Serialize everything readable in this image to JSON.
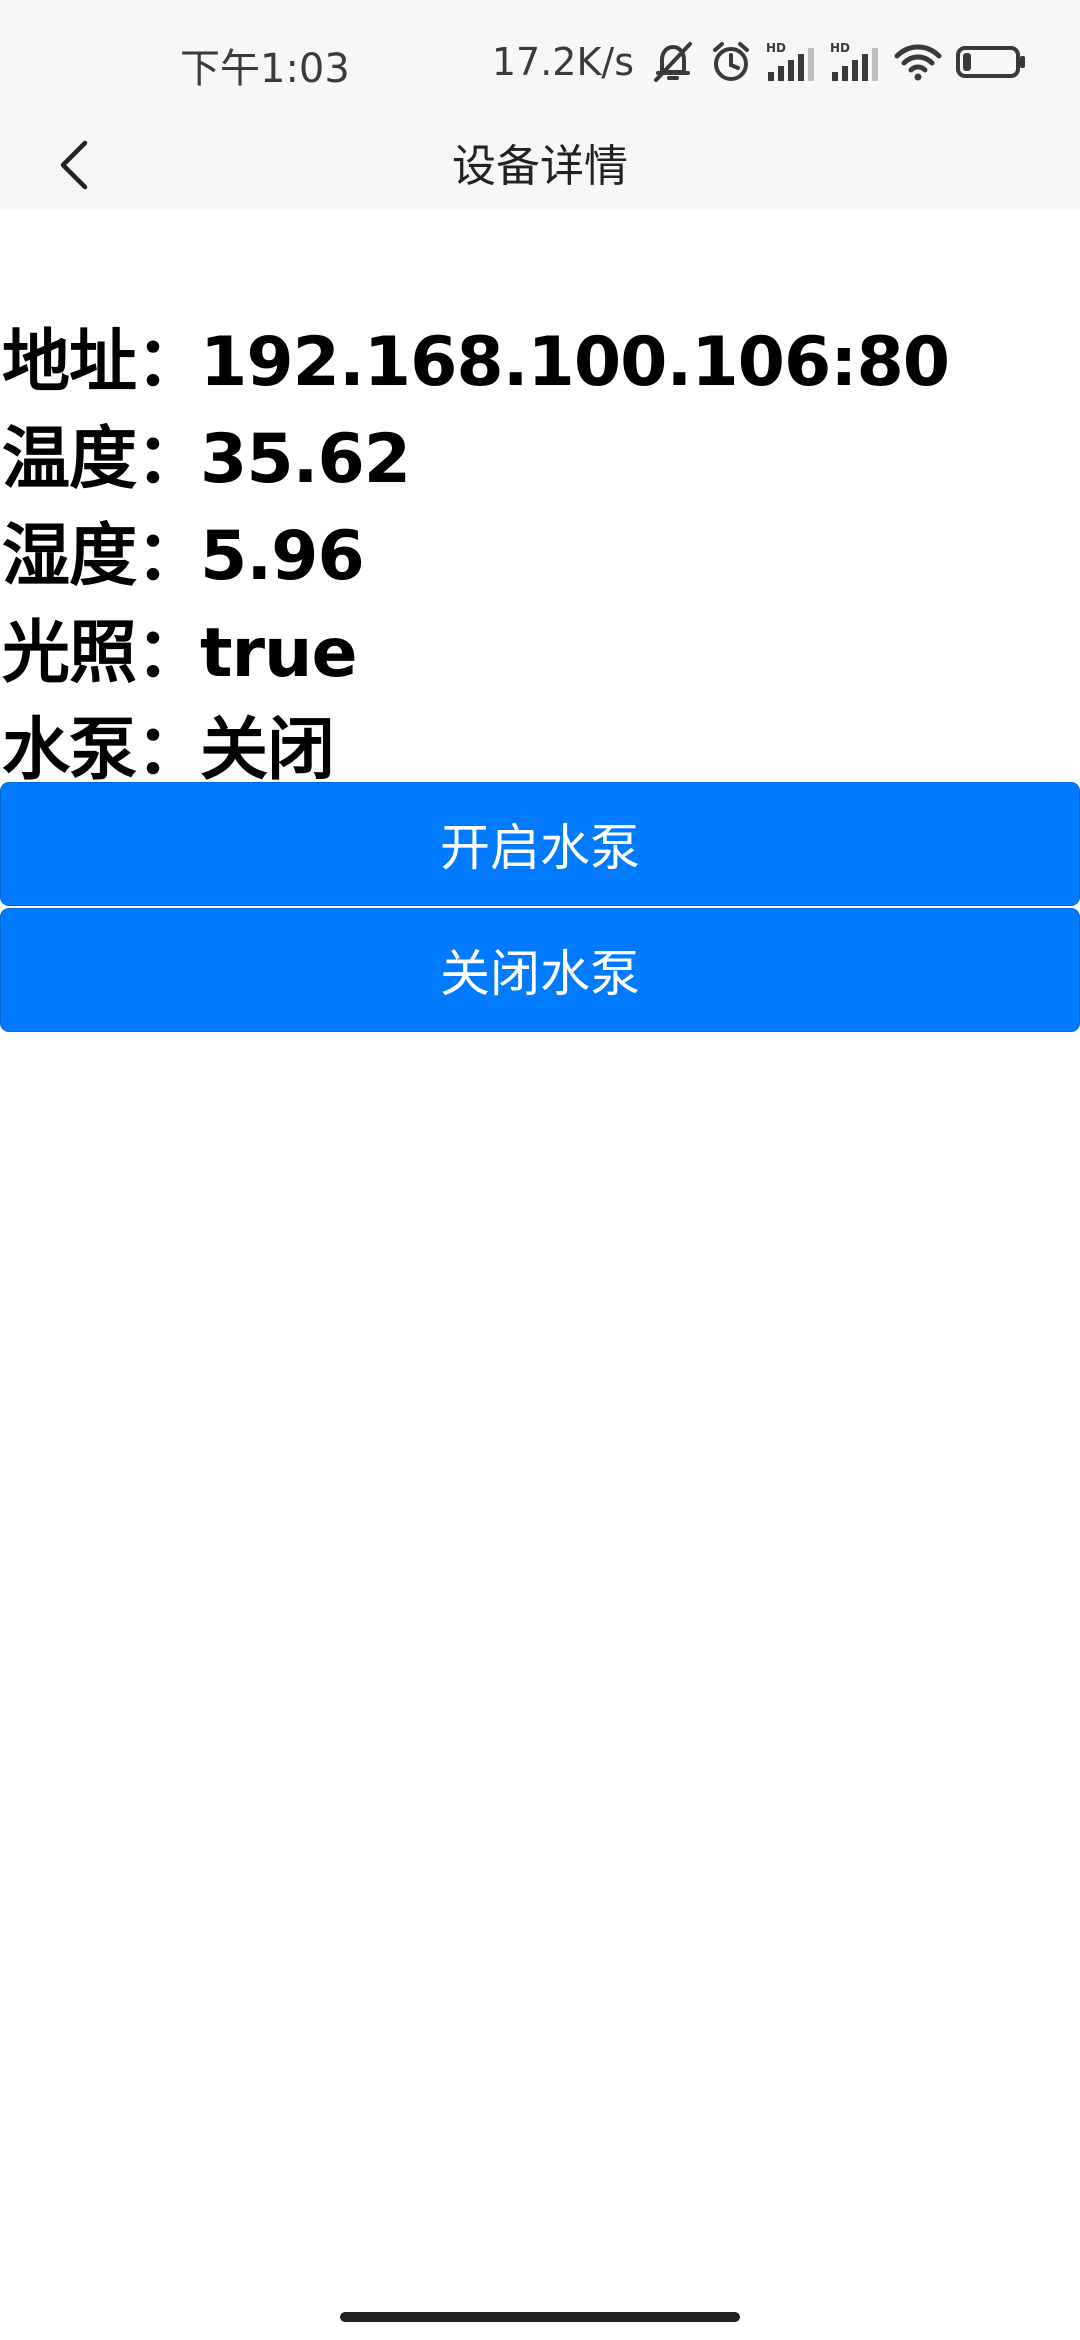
{
  "status_bar": {
    "time": "下午1:03",
    "net_speed": "17.2K/s",
    "icons": [
      "mute-bell-icon",
      "alarm-icon",
      "signal-hd-icon",
      "signal-hd-icon",
      "wifi-icon",
      "battery-icon"
    ],
    "hd_label": "HD",
    "battery_level": 0.15
  },
  "header": {
    "back_icon": "chevron-left-icon",
    "title": "设备详情"
  },
  "info": [
    {
      "label": "地址：",
      "value": "192.168.100.106:80"
    },
    {
      "label": "温度：",
      "value": "35.62"
    },
    {
      "label": "湿度：",
      "value": "5.96"
    },
    {
      "label": "光照：",
      "value": "true"
    },
    {
      "label": "水泵：",
      "value": "关闭"
    }
  ],
  "buttons": {
    "open_pump": "开启水泵",
    "close_pump": "关闭水泵"
  },
  "colors": {
    "primary": "#007bff",
    "bar_background": "#f7f7f7"
  }
}
